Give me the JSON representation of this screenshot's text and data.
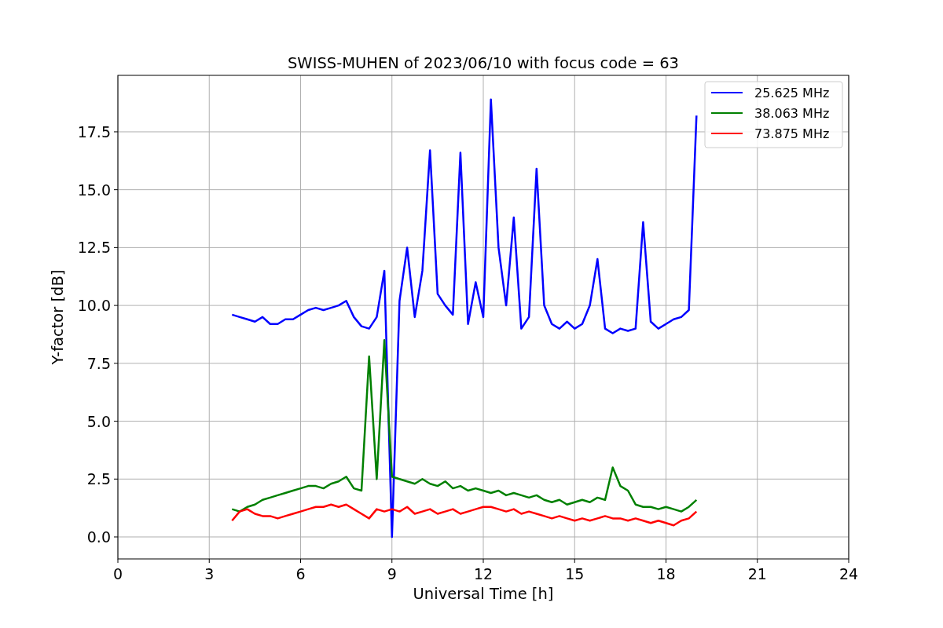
{
  "chart_data": {
    "type": "line",
    "title": "SWISS-MUHEN of 2023/06/10 with focus code = 63",
    "xlabel": "Universal Time [h]",
    "ylabel": "Y-factor [dB]",
    "x": [
      3.75,
      4.0,
      4.25,
      4.5,
      4.75,
      5.0,
      5.25,
      5.5,
      5.75,
      6.0,
      6.25,
      6.5,
      6.75,
      7.0,
      7.25,
      7.5,
      7.75,
      8.0,
      8.25,
      8.5,
      8.75,
      9.0,
      9.25,
      9.5,
      9.75,
      10.0,
      10.25,
      10.5,
      10.75,
      11.0,
      11.25,
      11.5,
      11.75,
      12.0,
      12.25,
      12.5,
      12.75,
      13.0,
      13.25,
      13.5,
      13.75,
      14.0,
      14.25,
      14.5,
      14.75,
      15.0,
      15.25,
      15.5,
      15.75,
      16.0,
      16.25,
      16.5,
      16.75,
      17.0,
      17.25,
      17.5,
      17.75,
      18.0,
      18.25,
      18.5,
      18.75,
      19.0
    ],
    "series": [
      {
        "name": "25.625 MHz",
        "color": "#0000ff",
        "values": [
          9.6,
          9.5,
          9.4,
          9.3,
          9.5,
          9.2,
          9.2,
          9.4,
          9.4,
          9.6,
          9.8,
          9.9,
          9.8,
          9.9,
          10.0,
          10.2,
          9.5,
          9.1,
          9.0,
          9.5,
          11.5,
          0.0,
          10.2,
          12.5,
          9.5,
          11.5,
          16.7,
          10.5,
          10.0,
          9.6,
          16.6,
          9.2,
          11.0,
          9.5,
          18.9,
          12.5,
          10.0,
          13.8,
          9.0,
          9.5,
          15.9,
          10.0,
          9.2,
          9.0,
          9.3,
          9.0,
          9.2,
          10.0,
          12.0,
          9.0,
          8.8,
          9.0,
          8.9,
          9.0,
          13.6,
          9.3,
          9.0,
          9.2,
          9.4,
          9.5,
          9.8,
          18.2
        ]
      },
      {
        "name": "38.063 MHz",
        "color": "#008000",
        "values": [
          1.2,
          1.1,
          1.3,
          1.4,
          1.6,
          1.7,
          1.8,
          1.9,
          2.0,
          2.1,
          2.2,
          2.2,
          2.1,
          2.3,
          2.4,
          2.6,
          2.1,
          2.0,
          7.8,
          2.5,
          8.5,
          2.6,
          2.5,
          2.4,
          2.3,
          2.5,
          2.3,
          2.2,
          2.4,
          2.1,
          2.2,
          2.0,
          2.1,
          2.0,
          1.9,
          2.0,
          1.8,
          1.9,
          1.8,
          1.7,
          1.8,
          1.6,
          1.5,
          1.6,
          1.4,
          1.5,
          1.6,
          1.5,
          1.7,
          1.6,
          3.0,
          2.2,
          2.0,
          1.4,
          1.3,
          1.3,
          1.2,
          1.3,
          1.2,
          1.1,
          1.3,
          1.6
        ]
      },
      {
        "name": "73.875 MHz",
        "color": "#ff0000",
        "values": [
          0.7,
          1.1,
          1.2,
          1.0,
          0.9,
          0.9,
          0.8,
          0.9,
          1.0,
          1.1,
          1.2,
          1.3,
          1.3,
          1.4,
          1.3,
          1.4,
          1.2,
          1.0,
          0.8,
          1.2,
          1.1,
          1.2,
          1.1,
          1.3,
          1.0,
          1.1,
          1.2,
          1.0,
          1.1,
          1.2,
          1.0,
          1.1,
          1.2,
          1.3,
          1.3,
          1.2,
          1.1,
          1.2,
          1.0,
          1.1,
          1.0,
          0.9,
          0.8,
          0.9,
          0.8,
          0.7,
          0.8,
          0.7,
          0.8,
          0.9,
          0.8,
          0.8,
          0.7,
          0.8,
          0.7,
          0.6,
          0.7,
          0.6,
          0.5,
          0.7,
          0.8,
          1.1
        ]
      }
    ],
    "grid": true,
    "legend": true,
    "xlim": [
      0,
      24
    ],
    "ylim": [
      -0.95,
      19.94
    ],
    "xticks": [
      0,
      3,
      6,
      9,
      12,
      15,
      18,
      21,
      24
    ],
    "yticks": [
      {
        "value": 0,
        "label": "0.0"
      },
      {
        "value": 2.5,
        "label": "2.5"
      },
      {
        "value": 5,
        "label": "5.0"
      },
      {
        "value": 7.5,
        "label": "7.5"
      },
      {
        "value": 10,
        "label": "10.0"
      },
      {
        "value": 12.5,
        "label": "12.5"
      },
      {
        "value": 15,
        "label": "15.0"
      },
      {
        "value": 17.5,
        "label": "17.5"
      }
    ]
  }
}
